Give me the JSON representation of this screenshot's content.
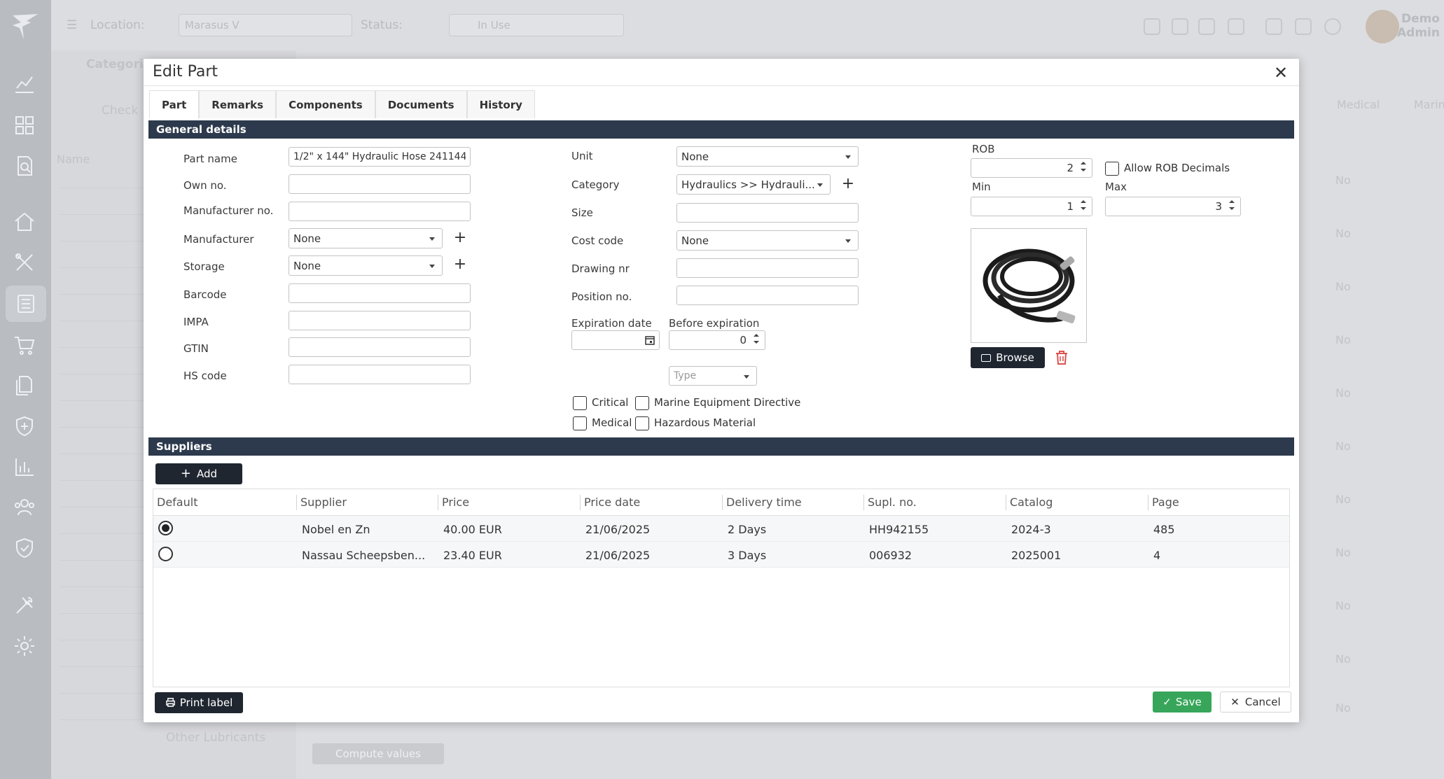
{
  "background": {
    "location_label": "Location:",
    "location_value": "Marasus V",
    "status_label": "Status:",
    "status_value": "In Use",
    "user_name_line1": "Demo",
    "user_name_line2": "Admin",
    "categories_label": "Categories",
    "check_label": "Check",
    "name_header": "Name",
    "col_medical": "Medical",
    "col_marine": "Marin",
    "no_value": "No",
    "other_lubricants": "Other Lubricants",
    "compute_button": "Compute values"
  },
  "modal": {
    "title": "Edit Part",
    "close": "✕",
    "tabs": [
      {
        "label": "Part"
      },
      {
        "label": "Remarks"
      },
      {
        "label": "Components"
      },
      {
        "label": "Documents"
      },
      {
        "label": "History"
      }
    ]
  },
  "general": {
    "section_title": "General details",
    "part_name_label": "Part name",
    "part_name_value": "1/2\" x 144\" Hydraulic Hose 241144",
    "own_no_label": "Own no.",
    "own_no_value": "",
    "manufacturer_no_label": "Manufacturer no.",
    "manufacturer_no_value": "",
    "manufacturer_label": "Manufacturer",
    "manufacturer_value": "None",
    "storage_label": "Storage",
    "storage_value": "None",
    "barcode_label": "Barcode",
    "barcode_value": "",
    "impa_label": "IMPA",
    "impa_value": "",
    "gtin_label": "GTIN",
    "gtin_value": "",
    "hs_code_label": "HS code",
    "hs_code_value": "",
    "unit_label": "Unit",
    "unit_value": "None",
    "category_label": "Category",
    "category_value": "Hydraulics >> Hydrauli...",
    "size_label": "Size",
    "size_value": "",
    "cost_code_label": "Cost code",
    "cost_code_value": "None",
    "drawing_nr_label": "Drawing nr",
    "drawing_nr_value": "",
    "position_no_label": "Position no.",
    "position_no_value": "",
    "expiration_date_label": "Expiration date",
    "expiration_date_value": "",
    "before_expiration_label": "Before expiration",
    "before_expiration_value": "0",
    "type_placeholder": "Type",
    "critical_label": "Critical",
    "marine_directive_label": "Marine Equipment Directive",
    "medical_label": "Medical",
    "hazardous_label": "Hazardous Material",
    "rob_label": "ROB",
    "rob_value": "2",
    "allow_rob_decimals_label": "Allow ROB Decimals",
    "min_label": "Min",
    "min_value": "1",
    "max_label": "Max",
    "max_value": "3",
    "browse_label": "Browse"
  },
  "suppliers": {
    "section_title": "Suppliers",
    "add_label": "Add",
    "columns": [
      "Default",
      "Supplier",
      "Price",
      "Price date",
      "Delivery time",
      "Supl. no.",
      "Catalog",
      "Page"
    ],
    "rows": [
      {
        "default": true,
        "supplier": "Nobel en Zn",
        "price": "40.00 EUR",
        "price_date": "21/06/2025",
        "delivery": "2 Days",
        "supl_no": "HH942155",
        "catalog": "2024-3",
        "page": "485"
      },
      {
        "default": false,
        "supplier": "Nassau Scheepsben...",
        "price": "23.40 EUR",
        "price_date": "21/06/2025",
        "delivery": "3 Days",
        "supl_no": "006932",
        "catalog": "2025001",
        "page": "4"
      }
    ]
  },
  "footer": {
    "print_label": "Print label",
    "save_label": "Save",
    "cancel_label": "Cancel"
  },
  "colors": {
    "section_bar": "#2d3a4d",
    "dark_button": "#1f2630",
    "save_green": "#37a65a",
    "trash_red": "#d9534f"
  }
}
